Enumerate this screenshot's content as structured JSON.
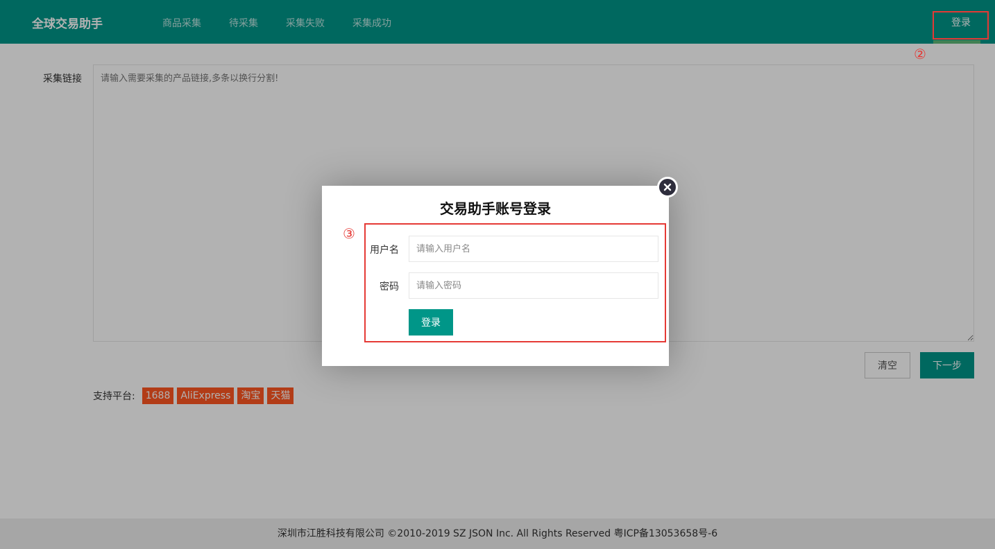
{
  "header": {
    "logo": "全球交易助手",
    "nav": [
      "商品采集",
      "待采集",
      "采集失败",
      "采集成功"
    ],
    "login_label": "登录"
  },
  "main": {
    "field_label": "采集链接",
    "textarea_placeholder": "请输入需要采集的产品链接,多条以换行分割!",
    "clear_label": "清空",
    "next_label": "下一步",
    "platforms_label": "支持平台:",
    "platforms": [
      "1688",
      "AliExpress",
      "淘宝",
      "天猫"
    ]
  },
  "footer": {
    "text": "深圳市江胜科技有限公司 ©2010-2019 SZ JSON Inc. All Rights Reserved 粤ICP备13053658号-6"
  },
  "modal": {
    "title": "交易助手账号登录",
    "username_label": "用户名",
    "username_placeholder": "请输入用户名",
    "password_label": "密码",
    "password_placeholder": "请输入密码",
    "submit_label": "登录"
  },
  "annotations": {
    "step2": "②",
    "step3": "③"
  },
  "colors": {
    "primary": "#009688",
    "tag": "#FF5722",
    "annotation": "#e53935"
  }
}
